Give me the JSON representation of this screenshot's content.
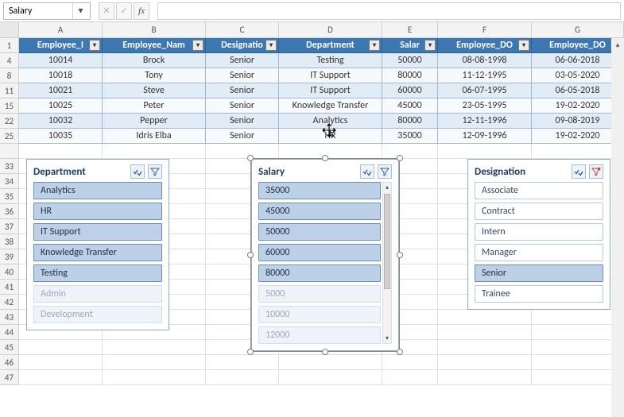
{
  "namebox": {
    "value": "Salary"
  },
  "formula_bar": {
    "cancel": "✕",
    "confirm": "✓",
    "fx": "fx",
    "value": ""
  },
  "col_headers": [
    "",
    "A",
    "B",
    "C",
    "D",
    "E",
    "F",
    "G"
  ],
  "table": {
    "header_row_num": "1",
    "headers": [
      "Employee_I",
      "Employee_Nam",
      "Designatio",
      "Department",
      "Salar",
      "Employee_DO",
      "Employee_DO"
    ],
    "rows": [
      {
        "num": "4",
        "cells": [
          "10014",
          "Brock",
          "Senior",
          "Testing",
          "50000",
          "08-08-1998",
          "06-06-2018"
        ]
      },
      {
        "num": "8",
        "cells": [
          "10018",
          "Tony",
          "Senior",
          "IT Support",
          "80000",
          "11-12-1995",
          "03-05-2020"
        ]
      },
      {
        "num": "11",
        "cells": [
          "10021",
          "Steve",
          "Senior",
          "IT Support",
          "60000",
          "06-07-1995",
          "06-05-2018"
        ]
      },
      {
        "num": "15",
        "cells": [
          "10025",
          "Peter",
          "Senior",
          "Knowledge Transfer",
          "45000",
          "23-05-1995",
          "19-02-2020"
        ]
      },
      {
        "num": "22",
        "cells": [
          "10032",
          "Pepper",
          "Senior",
          "Analytics",
          "80000",
          "12-11-1996",
          "09-08-2019"
        ]
      },
      {
        "num": "25",
        "cells": [
          "10035",
          "Idris Elba",
          "Senior",
          "HR",
          "35000",
          "12-09-1996",
          "19-02-2020"
        ]
      }
    ]
  },
  "empty_row_nums": [
    "",
    "33",
    "34",
    "35",
    "36",
    "37",
    "38",
    "39",
    "40",
    "41",
    "42",
    "43",
    "44",
    "45",
    "46",
    "47"
  ],
  "slicers": {
    "department": {
      "title": "Department",
      "items": [
        {
          "label": "Analytics",
          "state": "sel"
        },
        {
          "label": "HR",
          "state": "sel"
        },
        {
          "label": "IT Support",
          "state": "sel"
        },
        {
          "label": "Knowledge Transfer",
          "state": "sel"
        },
        {
          "label": "Testing",
          "state": "sel"
        },
        {
          "label": "Admin",
          "state": "off"
        },
        {
          "label": "Development",
          "state": "off"
        }
      ]
    },
    "salary": {
      "title": "Salary",
      "items": [
        {
          "label": "35000",
          "state": "sel"
        },
        {
          "label": "45000",
          "state": "sel"
        },
        {
          "label": "50000",
          "state": "sel"
        },
        {
          "label": "60000",
          "state": "sel"
        },
        {
          "label": "80000",
          "state": "sel"
        },
        {
          "label": "5000",
          "state": "off"
        },
        {
          "label": "10000",
          "state": "off"
        },
        {
          "label": "12000",
          "state": "off"
        }
      ]
    },
    "designation": {
      "title": "Designation",
      "items": [
        {
          "label": "Associate",
          "state": "plain"
        },
        {
          "label": "Contract",
          "state": "plain"
        },
        {
          "label": "Intern",
          "state": "plain"
        },
        {
          "label": "Manager",
          "state": "plain"
        },
        {
          "label": "Senior",
          "state": "sel"
        },
        {
          "label": "Trainee",
          "state": "plain"
        }
      ]
    }
  }
}
